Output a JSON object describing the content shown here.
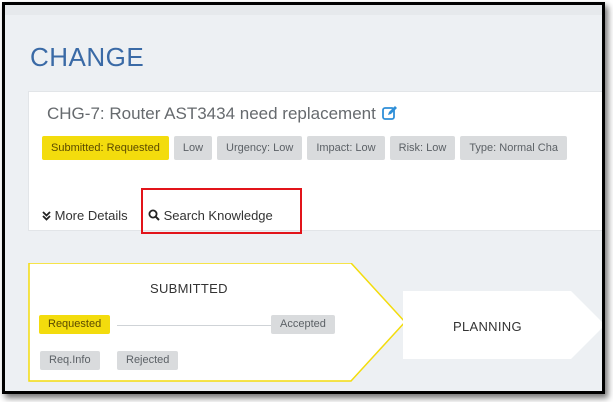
{
  "page": {
    "title": "CHANGE"
  },
  "change": {
    "title": "CHG-7: Router AST3434 need replacement",
    "tags": [
      {
        "label": "Submitted: Requested",
        "color": "#f3dc0d"
      },
      {
        "label": "Low",
        "color": "#d9dbdd"
      },
      {
        "label": "Urgency: Low",
        "color": "#d9dbdd"
      },
      {
        "label": "Impact: Low",
        "color": "#d9dbdd"
      },
      {
        "label": "Risk: Low",
        "color": "#d9dbdd"
      },
      {
        "label": "Type: Normal Cha",
        "color": "#d9dbdd"
      }
    ],
    "more_details_label": "More Details",
    "search_knowledge_label": "Search Knowledge"
  },
  "workflow": {
    "stages": [
      {
        "label": "SUBMITTED",
        "active": true,
        "steps": [
          {
            "label": "Requested",
            "state": "current",
            "color": "#f3dc0d"
          },
          {
            "label": "Accepted",
            "state": "pending"
          },
          {
            "label": "Req.Info",
            "state": "pending"
          },
          {
            "label": "Rejected",
            "state": "pending"
          }
        ]
      },
      {
        "label": "PLANNING",
        "active": false
      }
    ]
  },
  "icons": {
    "edit": "edit-icon",
    "more_details": "double-chevron-down-icon",
    "search": "search-icon"
  },
  "colors": {
    "accent": "#3a6aa6",
    "active_stage_border": "#f3dc0d",
    "highlight": "#e2141a",
    "edit_icon": "#2f8fd8"
  }
}
